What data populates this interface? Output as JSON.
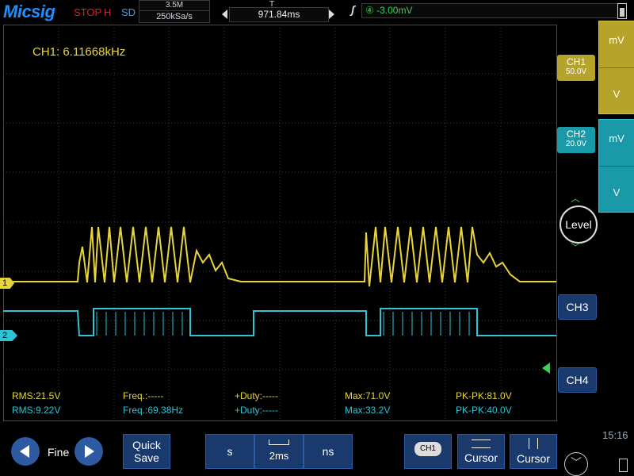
{
  "topbar": {
    "brand": "Micsig",
    "status": "STOP",
    "h_flag": "H",
    "storage": "SD",
    "memory_depth": "3.5M",
    "sample_rate": "250kSa/s",
    "timebase_marker": "T",
    "time_position": "971.84ms",
    "trigger_channel": "④",
    "trigger_level": "-3.00mV"
  },
  "screen": {
    "frequency_readout": "CH1: 6.11668kHz",
    "ch1_marker": "1",
    "ch2_marker": "2",
    "measurements": {
      "row1": {
        "rms": "RMS:21.5V",
        "freq": "Freq.:-----",
        "duty": "+Duty:-----",
        "max": "Max:71.0V",
        "pkpk": "PK-PK:81.0V"
      },
      "row2": {
        "rms": "RMS:9.22V",
        "freq": "Freq.:69.38Hz",
        "duty": "+Duty:-----",
        "max": "Max:33.2V",
        "pkpk": "PK-PK:40.0V"
      }
    }
  },
  "right_panel": {
    "ch1": {
      "label": "CH1",
      "scale": "50.0V"
    },
    "ch2": {
      "label": "CH2",
      "scale": "20.0V"
    },
    "ch1_units": {
      "top": "mV",
      "bottom": "V"
    },
    "ch2_units": {
      "top": "mV",
      "bottom": "V"
    },
    "level_label": "Level",
    "ch3_label": "CH3",
    "ch4_label": "CH4"
  },
  "bottombar": {
    "fine_label": "Fine",
    "quick_save_line1": "Quick",
    "quick_save_line2": "Save",
    "time_unit_s": "s",
    "time_value": "2ms",
    "time_unit_ns": "ns",
    "ch1_chip": "CH1",
    "cursor_h_label": "Cursor",
    "cursor_v_label": "Cursor",
    "clock": "15:16"
  },
  "colors": {
    "ch1": "#e8d43a",
    "ch2": "#2ec4d6",
    "trigger": "#39d353",
    "brand": "#1e90ff",
    "stop": "#e02020",
    "button": "#1a3a6e"
  }
}
